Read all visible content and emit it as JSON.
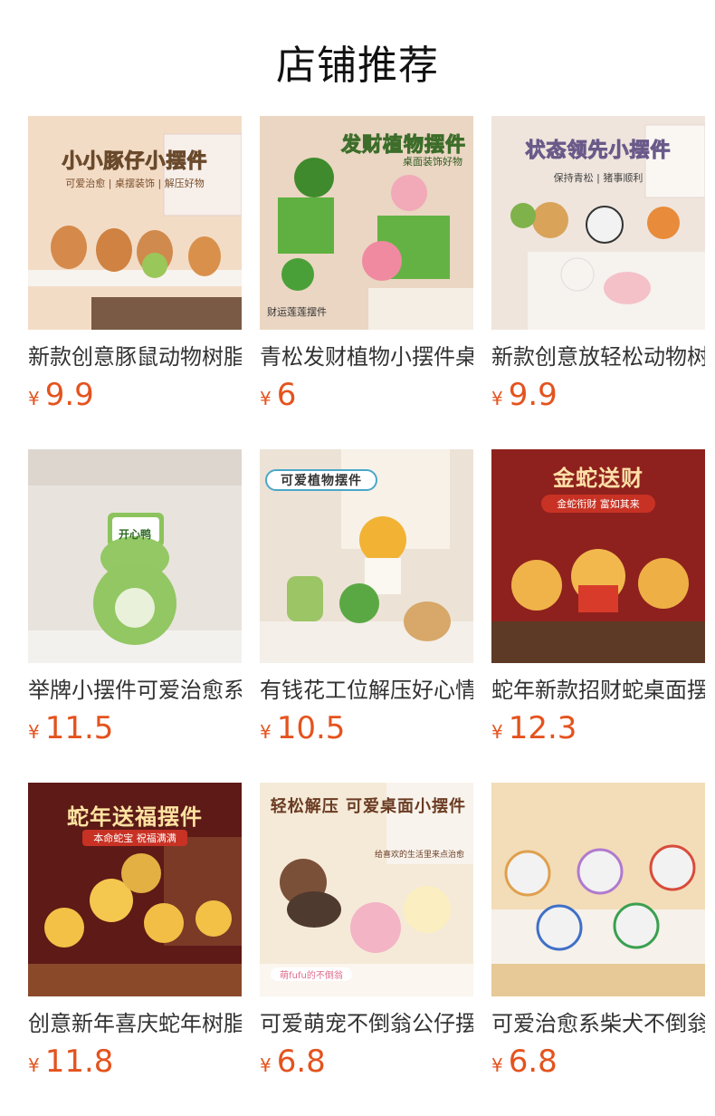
{
  "page": {
    "title": "店铺推荐"
  },
  "currency": "¥",
  "products": [
    {
      "name": "新款创意豚鼠动物树脂小摆件",
      "price": "9.9",
      "banner": "小小豚仔小摆件",
      "sub": "可爱治愈 | 桌摆装饰 | 解压好物",
      "tag": "",
      "bg": "#f4dcc4",
      "accent": "#d99a58"
    },
    {
      "name": "青松发财植物小摆件桌面装饰",
      "price": "6",
      "banner": "发财植物摆件",
      "sub": "桌面装饰好物",
      "tag": "财运莲莲摆件",
      "bg": "#ead7c2",
      "accent": "#4e9a3a"
    },
    {
      "name": "新款创意放轻松动物树脂摆件",
      "price": "9.9",
      "banner": "状态领先小摆件",
      "sub": "保持青松 | 猪事顺利",
      "tag": "",
      "bg": "#ede3da",
      "accent": "#7fb24a"
    },
    {
      "name": "举牌小摆件可爱治愈系青蛙",
      "price": "11.5",
      "banner": "",
      "sub": "",
      "tag": "开心鸭",
      "bg": "#e9e4dd",
      "accent": "#8cc35c"
    },
    {
      "name": "有钱花工位解压好心情摆件",
      "price": "10.5",
      "banner": "可爱植物摆件",
      "sub": "",
      "tag": "",
      "bg": "#efe6da",
      "accent": "#f2b233"
    },
    {
      "name": "蛇年新款招财蛇桌面摆件",
      "price": "12.3",
      "banner": "金蛇送财",
      "sub": "金蛇衔财 富如其来",
      "tag": "",
      "bg": "#8c1f1c",
      "accent": "#f0b34a"
    },
    {
      "name": "创意新年喜庆蛇年树脂摆件",
      "price": "11.8",
      "banner": "蛇年送福摆件",
      "sub": "本命蛇宝 祝福满满",
      "tag": "",
      "bg": "#5e1a16",
      "accent": "#f2c146"
    },
    {
      "name": "可爱萌宠不倒翁公仔摆件",
      "price": "6.8",
      "banner": "轻松解压 可爱桌面小摆件",
      "sub": "给喜欢的生活里来点治愈",
      "tag": "萌fufu的不倒翁",
      "bg": "#f5ead8",
      "accent": "#8c5a3c"
    },
    {
      "name": "可爱治愈系柴犬不倒翁摆件",
      "price": "6.8",
      "banner": "",
      "sub": "",
      "tag": "",
      "bg": "#f3ddb8",
      "accent": "#e3a248"
    }
  ]
}
